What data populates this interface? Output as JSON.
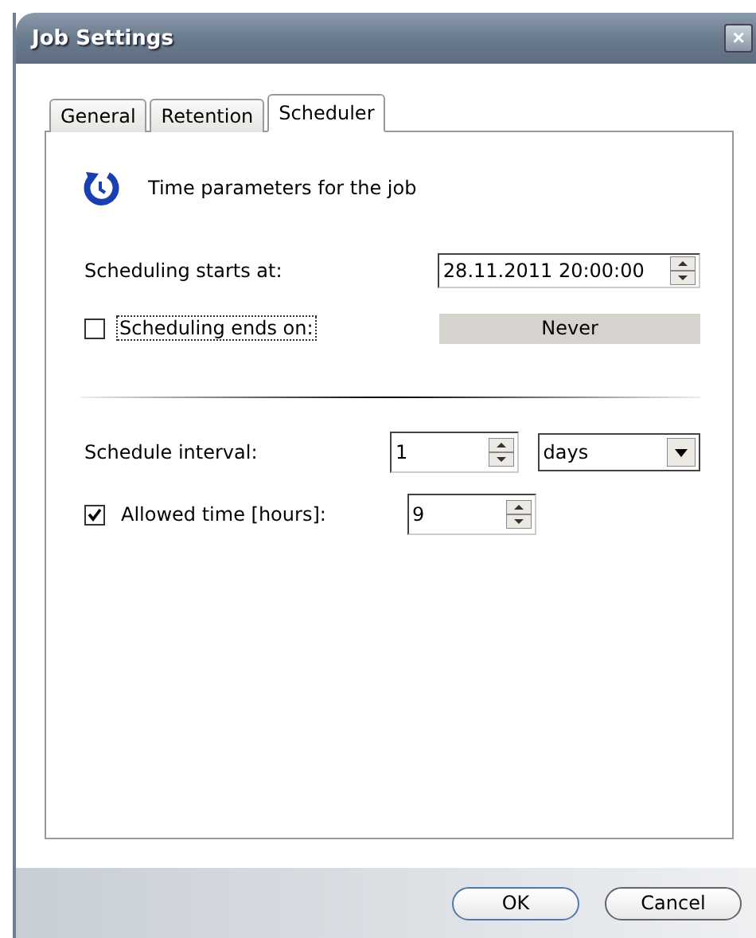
{
  "window": {
    "title": "Job Settings",
    "close": "×"
  },
  "tabs": [
    {
      "label": "General",
      "selected": false
    },
    {
      "label": "Retention",
      "selected": false
    },
    {
      "label": "Scheduler",
      "selected": true
    }
  ],
  "header": {
    "text": "Time parameters for the job"
  },
  "start": {
    "label": "Scheduling starts at:",
    "value": "28.11.2011 20:00:00"
  },
  "end": {
    "label": "Scheduling ends on:",
    "checked": false,
    "focused": true,
    "button": "Never"
  },
  "interval": {
    "label": "Schedule interval:",
    "value": "1",
    "unit": "days"
  },
  "allowed": {
    "label": "Allowed time [hours]:",
    "checked": true,
    "value": "9"
  },
  "buttons": [
    {
      "label": "OK",
      "default": true
    },
    {
      "label": "Cancel",
      "default": false
    }
  ]
}
